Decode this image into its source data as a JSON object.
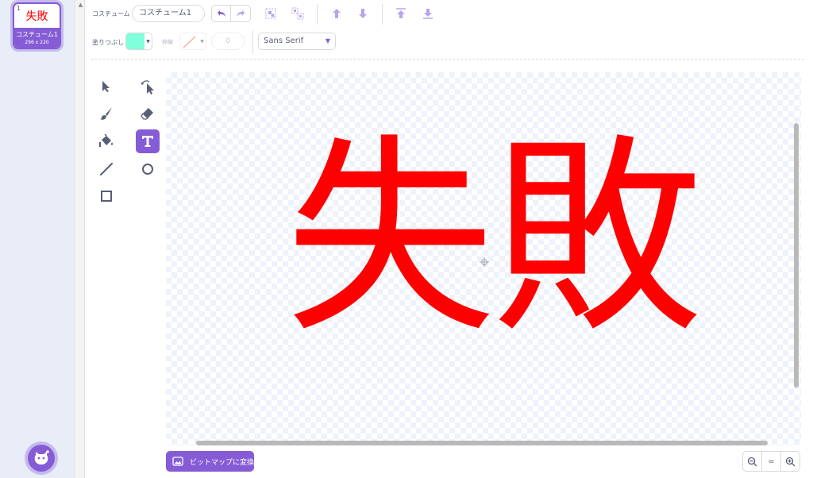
{
  "costume_list": {
    "items": [
      {
        "index": "1",
        "thumb_text": "失敗",
        "name": "コスチューム1",
        "size": "296 x 220"
      }
    ]
  },
  "toolbar": {
    "costume_label": "コスチューム",
    "costume_name": "コスチューム1",
    "fill_label": "塗りつぶし",
    "fill_color": "#80ffdc",
    "outline_label": "枠線",
    "outline_width": "0",
    "font": "Sans Serif"
  },
  "canvas": {
    "text": "失敗",
    "text_color": "#ff0000"
  },
  "bottom": {
    "bitmap_button": "ビットマップに変換",
    "zoom_reset": "="
  },
  "colors": {
    "accent": "#855cd6",
    "tool_gray": "#575e75",
    "disabled_icon": "#b8a4eb"
  }
}
